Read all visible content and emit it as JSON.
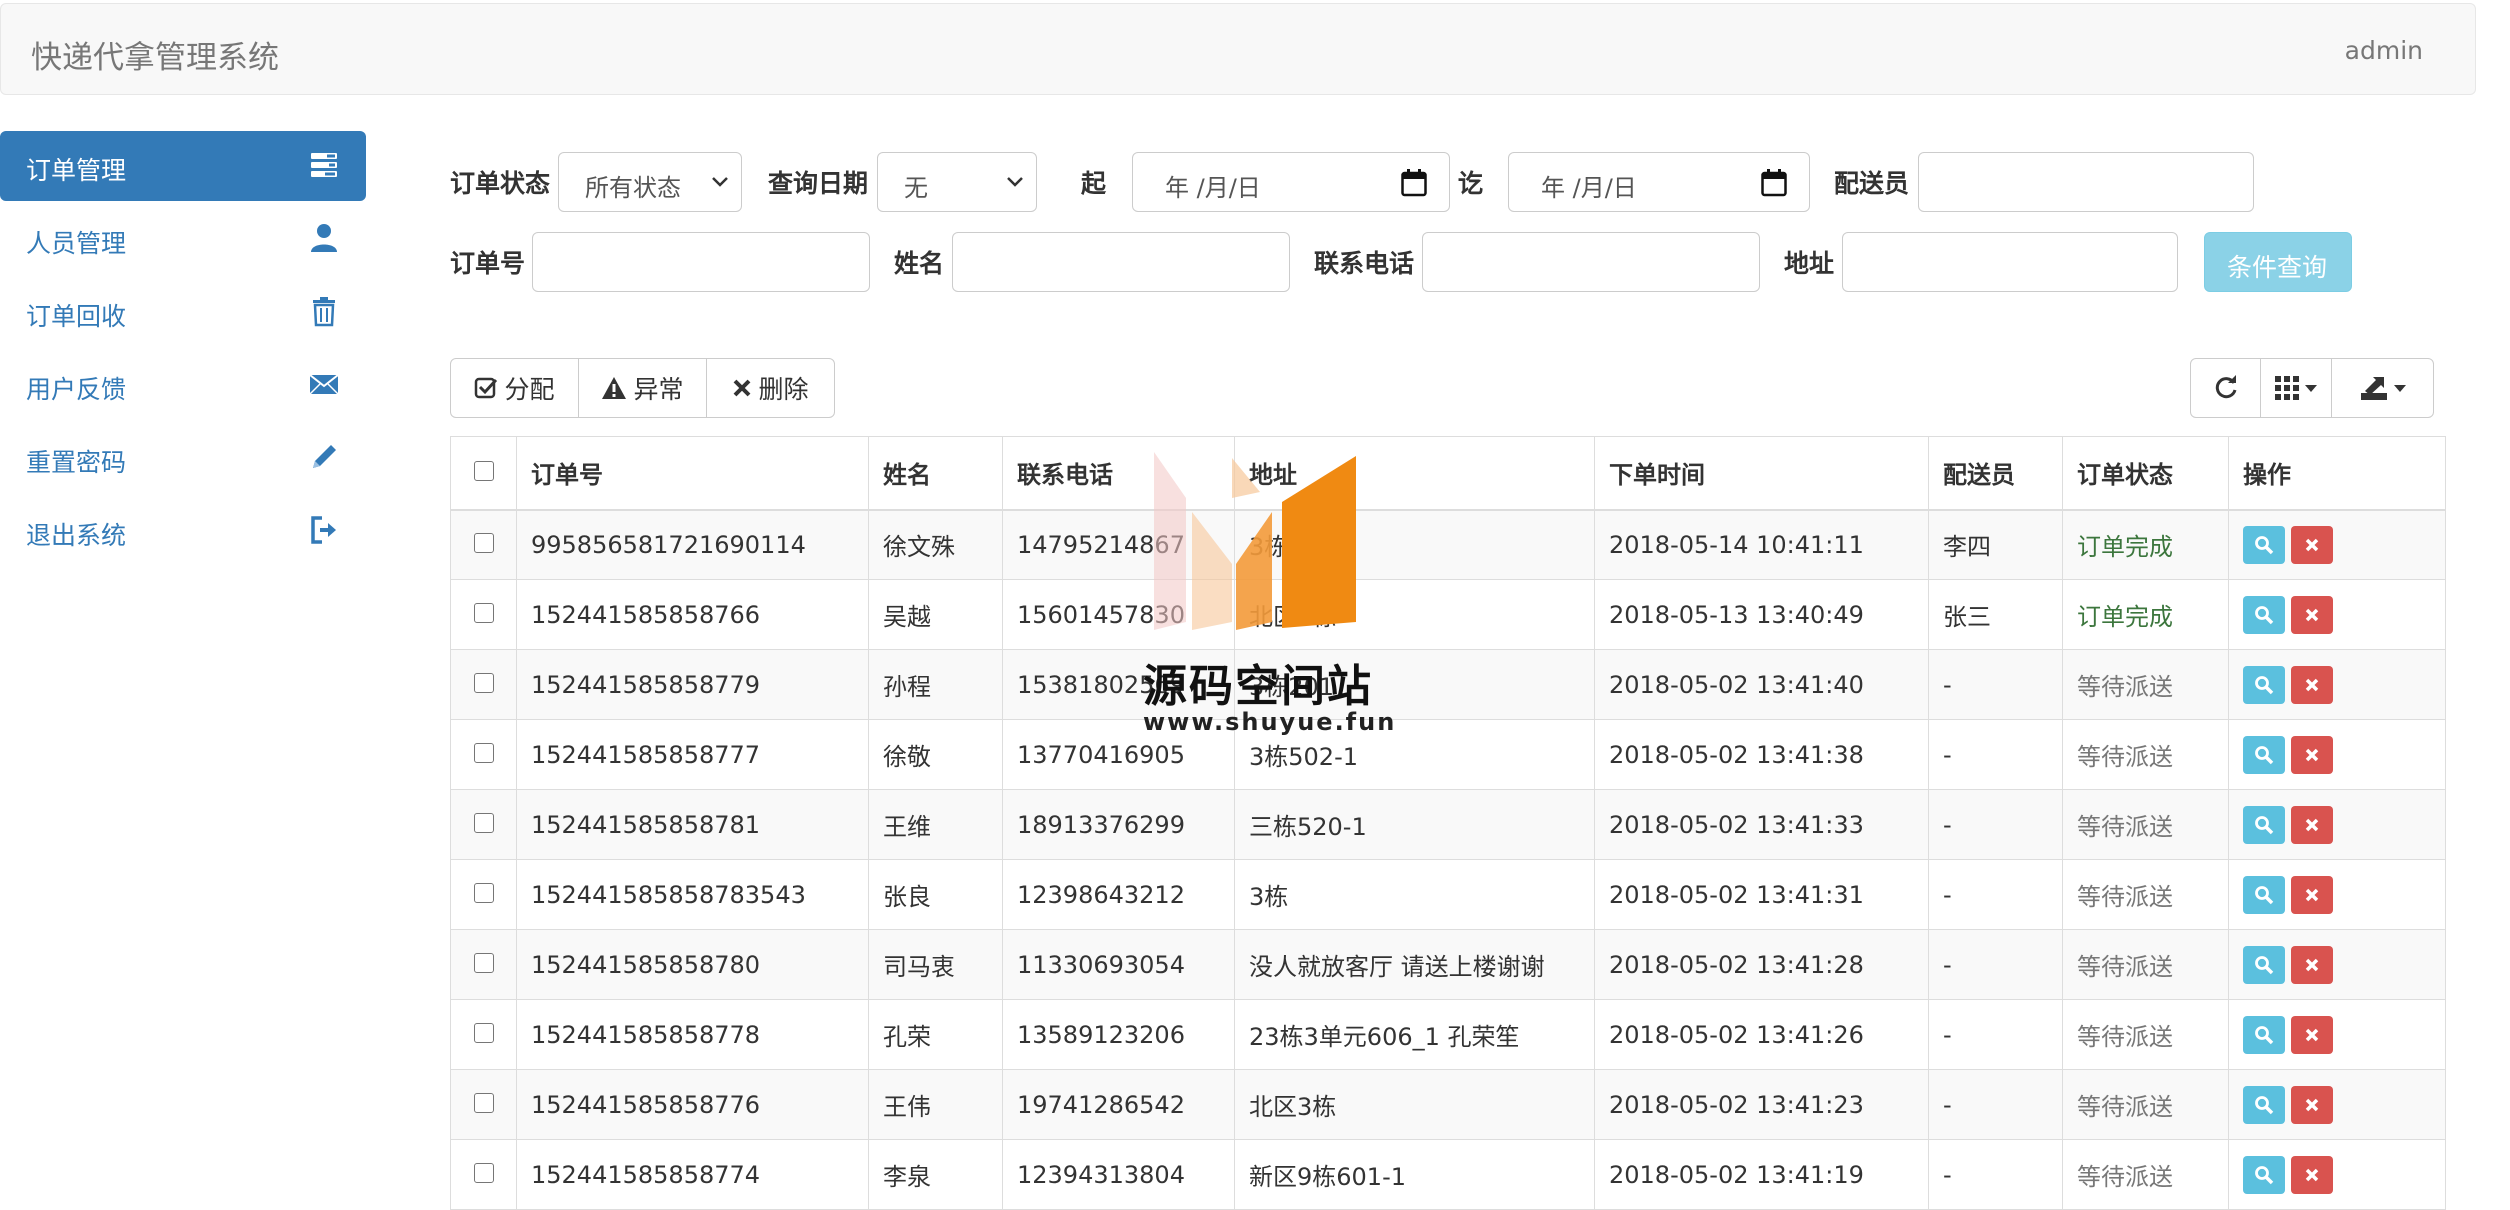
{
  "app": {
    "title": "快递代拿管理系统",
    "user": "admin"
  },
  "sidebar": {
    "items": [
      {
        "label": "订单管理",
        "icon": "tasks-icon",
        "active": true
      },
      {
        "label": "人员管理",
        "icon": "user-icon"
      },
      {
        "label": "订单回收",
        "icon": "trash-icon"
      },
      {
        "label": "用户反馈",
        "icon": "envelope-icon"
      },
      {
        "label": "重置密码",
        "icon": "pencil-icon"
      },
      {
        "label": "退出系统",
        "icon": "logout-icon"
      }
    ]
  },
  "filters": {
    "status_label": "订单状态",
    "status_value": "所有状态",
    "date_label": "查询日期",
    "date_value": "无",
    "from_label": "起",
    "from_placeholder": "年 /月/日",
    "to_label": "讫",
    "to_placeholder": "年 /月/日",
    "courier_label": "配送员",
    "courier_value": "",
    "order_no_label": "订单号",
    "order_no_value": "",
    "name_label": "姓名",
    "name_value": "",
    "phone_label": "联系电话",
    "phone_value": "",
    "address_label": "地址",
    "address_value": "",
    "query_button": "条件查询"
  },
  "toolbar": {
    "assign": "分配",
    "abnormal": "异常",
    "delete": "删除"
  },
  "table": {
    "headers": [
      "订单号",
      "姓名",
      "联系电话",
      "地址",
      "下单时间",
      "配送员",
      "订单状态",
      "操作"
    ],
    "rows": [
      {
        "order_no": "995856581721690114",
        "name": "徐文殊",
        "phone": "14795214867",
        "address": "3栋402",
        "time": "2018-05-14 10:41:11",
        "courier": "李四",
        "status": "订单完成"
      },
      {
        "order_no": "152441585858766",
        "name": "吴越",
        "phone": "15601457830",
        "address": "北区1栋",
        "time": "2018-05-13 13:40:49",
        "courier": "张三",
        "status": "订单完成"
      },
      {
        "order_no": "152441585858779",
        "name": "孙程",
        "phone": "15381802569",
        "address": "3栋201",
        "time": "2018-05-02 13:41:40",
        "courier": "-",
        "status": "等待派送"
      },
      {
        "order_no": "152441585858777",
        "name": "徐敬",
        "phone": "13770416905",
        "address": "3栋502-1",
        "time": "2018-05-02 13:41:38",
        "courier": "-",
        "status": "等待派送"
      },
      {
        "order_no": "152441585858781",
        "name": "王维",
        "phone": "18913376299",
        "address": "三栋520-1",
        "time": "2018-05-02 13:41:33",
        "courier": "-",
        "status": "等待派送"
      },
      {
        "order_no": "152441585858783543",
        "name": "张良",
        "phone": "12398643212",
        "address": "3栋",
        "time": "2018-05-02 13:41:31",
        "courier": "-",
        "status": "等待派送"
      },
      {
        "order_no": "152441585858780",
        "name": "司马衷",
        "phone": "11330693054",
        "address": "没人就放客厅 请送上楼谢谢",
        "time": "2018-05-02 13:41:28",
        "courier": "-",
        "status": "等待派送"
      },
      {
        "order_no": "152441585858778",
        "name": "孔荣",
        "phone": "13589123206",
        "address": "23栋3单元606_1 孔荣笙",
        "time": "2018-05-02 13:41:26",
        "courier": "-",
        "status": "等待派送"
      },
      {
        "order_no": "152441585858776",
        "name": "王伟",
        "phone": "19741286542",
        "address": "北区3栋",
        "time": "2018-05-02 13:41:23",
        "courier": "-",
        "status": "等待派送"
      },
      {
        "order_no": "152441585858774",
        "name": "李泉",
        "phone": "12394313804",
        "address": "新区9栋601-1",
        "time": "2018-05-02 13:41:19",
        "courier": "-",
        "status": "等待派送"
      }
    ]
  },
  "watermark": {
    "title": "源码空间站",
    "url": "www.shuyue.fun"
  },
  "colors": {
    "primary": "#337ab7",
    "info": "#5bc0de",
    "danger": "#d9534f",
    "success_text": "#3c763d"
  }
}
